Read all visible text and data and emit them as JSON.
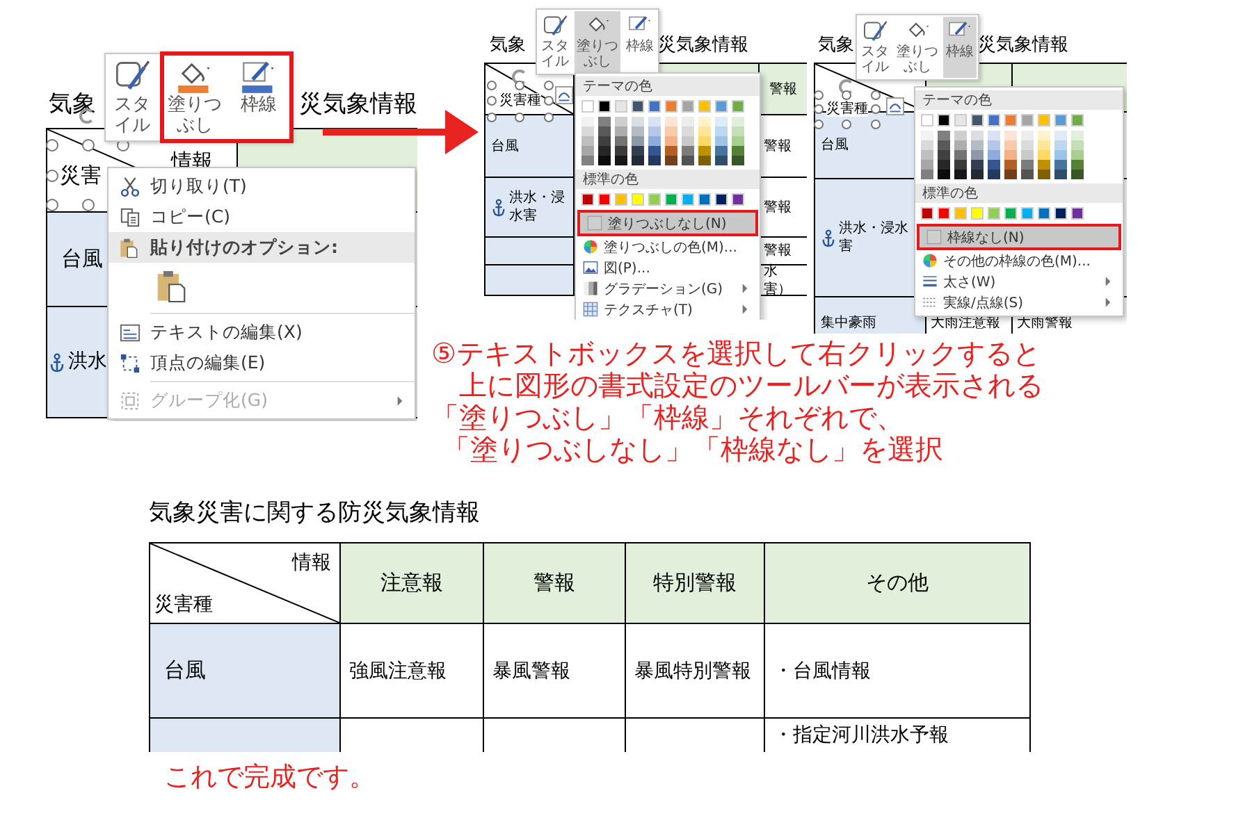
{
  "panels": [
    {
      "title_left": "気象",
      "title_right": "災気象情報",
      "diag_label": "情報",
      "textbox": "災害",
      "rows": [
        {
          "label": "台風",
          "anchored": false
        },
        {
          "label": "洪水",
          "anchored": true
        }
      ],
      "toolbar": [
        {
          "kind": "style",
          "label": "スタイル",
          "selected": false,
          "framed": false
        },
        {
          "kind": "fill",
          "label": "塗りつぶし",
          "color": "#ed7d31",
          "selected": false,
          "framed": true
        },
        {
          "kind": "border",
          "label": "枠線",
          "color": "#4472c4",
          "selected": false,
          "framed": true
        }
      ],
      "menu": [
        {
          "kind": "cut",
          "label": "切り取り(T)",
          "disabled": false,
          "submenu": false
        },
        {
          "kind": "copy",
          "label": "コピー(C)",
          "disabled": false,
          "submenu": false
        },
        {
          "kind": "paste_section",
          "label": "貼り付けのオプション:"
        },
        {
          "kind": "paste_option"
        },
        {
          "kind": "separator"
        },
        {
          "kind": "edit_text",
          "label": "テキストの編集(X)",
          "disabled": false,
          "submenu": false
        },
        {
          "kind": "edit_points",
          "label": "頂点の編集(E)",
          "disabled": false,
          "submenu": false
        },
        {
          "kind": "separator"
        },
        {
          "kind": "group",
          "label": "グループ化(G)",
          "disabled": true,
          "submenu": true
        }
      ]
    },
    {
      "title_left": "気象",
      "title_right": "災気象情報",
      "textbox": "災害種",
      "header_labels": [
        "警報"
      ],
      "rows": [
        {
          "label": "台風",
          "anchored": false,
          "cells": [
            "警報"
          ]
        },
        {
          "label": "洪水・浸水害",
          "anchored": true,
          "cells": [
            "警報"
          ]
        },
        {
          "cells": [
            "警報"
          ]
        },
        {
          "cells": [
            "水害）"
          ]
        }
      ],
      "toolbar": [
        {
          "kind": "style",
          "label": "スタイル",
          "selected": false,
          "framed": false
        },
        {
          "kind": "fill",
          "label": "塗りつぶし",
          "selected": true,
          "framed": false
        },
        {
          "kind": "border",
          "label": "枠線",
          "selected": false,
          "framed": false
        }
      ],
      "menu": [
        {
          "kind": "section",
          "label": "テーマの色"
        },
        {
          "kind": "theme_palette",
          "colors": [
            {
              "color": "#ffffff"
            },
            {
              "color": "#000000"
            },
            {
              "color": "#e7e6e6"
            },
            {
              "color": "#44546a"
            },
            {
              "color": "#4472c4"
            },
            {
              "color": "#ed7d31"
            },
            {
              "color": "#a5a5a5"
            },
            {
              "color": "#ffc000"
            },
            {
              "color": "#5b9bd5"
            },
            {
              "color": "#70ad47"
            }
          ]
        },
        {
          "kind": "section",
          "label": "標準の色"
        },
        {
          "kind": "standard_palette",
          "colors": [
            {
              "color": "#c00000"
            },
            {
              "color": "#ff0000"
            },
            {
              "color": "#ffc000"
            },
            {
              "color": "#ffff00"
            },
            {
              "color": "#92d050"
            },
            {
              "color": "#00b050"
            },
            {
              "color": "#00b0f0"
            },
            {
              "color": "#0070c0"
            },
            {
              "color": "#002060"
            },
            {
              "color": "#7030a0"
            }
          ]
        },
        {
          "kind": "no_fill",
          "label": "塗りつぶしなし(N)",
          "selected": true,
          "framed": true,
          "submenu": false
        },
        {
          "kind": "fill_color",
          "label": "塗りつぶしの色(M)...",
          "selected": false,
          "framed": false,
          "submenu": false
        },
        {
          "kind": "picture",
          "label": "図(P)...",
          "selected": false,
          "framed": false,
          "submenu": false
        },
        {
          "kind": "gradient",
          "label": "グラデーション(G)",
          "selected": false,
          "framed": false,
          "submenu": true
        },
        {
          "kind": "texture",
          "label": "テクスチャ(T)",
          "selected": false,
          "framed": false,
          "submenu": true
        }
      ]
    },
    {
      "title_left": "気象",
      "title_right": "災気象情報",
      "textbox": "災害種",
      "rows": [
        {
          "label": "台風",
          "anchored": false
        },
        {
          "label": "洪水・浸水害",
          "anchored": true
        },
        {
          "label": "集中豪雨",
          "anchored": false,
          "cells": [
            "大雨注意報",
            "大雨警報"
          ]
        }
      ],
      "toolbar": [
        {
          "kind": "style",
          "label": "スタイル",
          "selected": false,
          "framed": false
        },
        {
          "kind": "fill",
          "label": "塗りつぶし",
          "selected": false,
          "framed": false
        },
        {
          "kind": "border",
          "label": "枠線",
          "selected": true,
          "framed": false
        }
      ],
      "menu": [
        {
          "kind": "section",
          "label": "テーマの色"
        },
        {
          "kind": "theme_palette",
          "colors": [
            {
              "color": "#ffffff"
            },
            {
              "color": "#000000"
            },
            {
              "color": "#e7e6e6"
            },
            {
              "color": "#44546a"
            },
            {
              "color": "#4472c4"
            },
            {
              "color": "#ed7d31"
            },
            {
              "color": "#a5a5a5"
            },
            {
              "color": "#ffc000"
            },
            {
              "color": "#5b9bd5"
            },
            {
              "color": "#70ad47"
            }
          ]
        },
        {
          "kind": "section",
          "label": "標準の色"
        },
        {
          "kind": "standard_palette",
          "colors": [
            {
              "color": "#c00000"
            },
            {
              "color": "#ff0000"
            },
            {
              "color": "#ffc000"
            },
            {
              "color": "#ffff00"
            },
            {
              "color": "#92d050"
            },
            {
              "color": "#00b050"
            },
            {
              "color": "#00b0f0"
            },
            {
              "color": "#0070c0"
            },
            {
              "color": "#002060"
            },
            {
              "color": "#7030a0"
            }
          ]
        },
        {
          "kind": "no_outline",
          "label": "枠線なし(N)",
          "selected": true,
          "framed": true,
          "submenu": false
        },
        {
          "kind": "outline_color",
          "label": "その他の枠線の色(M)...",
          "selected": false,
          "framed": false,
          "submenu": false
        },
        {
          "kind": "weight",
          "label": "太さ(W)",
          "selected": false,
          "framed": false,
          "submenu": true
        },
        {
          "kind": "dashes",
          "label": "実線/点線(S)",
          "selected": false,
          "framed": false,
          "submenu": true
        }
      ]
    }
  ],
  "step_note": [
    "⑤テキストボックスを選択して右クリックすると",
    "上に図形の書式設定のツールバーが表示される",
    "「塗りつぶし」「枠線」それぞれで、",
    "「塗りつぶしなし」「枠線なし」を選択"
  ],
  "document": {
    "title": "気象災害に関する防災気象情報",
    "corner_top": "情報",
    "corner_bottom": "災害種",
    "columns": [
      "注意報",
      "警報",
      "特別警報",
      "その他"
    ],
    "rows": [
      {
        "label": "台風",
        "cells": [
          "強風注意報",
          "暴風警報",
          "暴風特別警報",
          "・台風情報"
        ]
      },
      {
        "cells": [
          "",
          "",
          "",
          "・指定河川洪水予報"
        ]
      }
    ]
  },
  "closing_note": "これで完成です。"
}
